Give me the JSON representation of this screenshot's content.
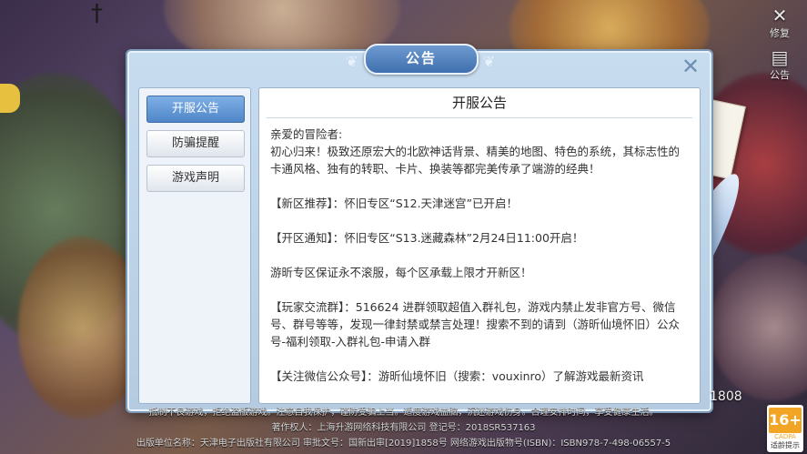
{
  "corner": {
    "repair_label": "修复",
    "notice_label": "公告"
  },
  "dialog": {
    "title": "公告",
    "tabs": [
      {
        "label": "开服公告"
      },
      {
        "label": "防骗提醒"
      },
      {
        "label": "游戏声明"
      }
    ],
    "content_title": "开服公告",
    "paragraphs": [
      "亲爱的冒险者:",
      "初心归来！极致还原宏大的北欧神话背景、精美的地图、特色的系统，其标志性的卡通风格、独有的转职、卡片、换装等都完美传承了端游的经典！",
      "【新区推荐】：怀旧专区“S12.天津迷宫”已开启！",
      "【开区通知】：怀旧专区“S13.迷藏森林”2月24日11:00开启！",
      "游昕专区保证永不滚服，每个区承载上限才开新区！",
      "【玩家交流群】：516624 进群领取超值入群礼包，游戏内禁止发非官方号、微信号、群号等等，发现一律封禁或禁言处理！搜索不到的请到（游昕仙境怀旧）公众号-福利领取-入群礼包-申请入群",
      "【关注微信公众号】：游昕仙境怀旧（搜索：vouxinro）了解游戏最新资讯"
    ]
  },
  "footer": {
    "line1": "抵制不良游戏，拒绝盗版游戏。注意自我保护，谨防受骗上当。适度游戏益脑，沉迷游戏伤身。合理安排时间，享受健康生活。",
    "line2": "著作权人：上海升游网络科技有限公司 登记号：2018SR537163",
    "line3": "出版单位名称：天津电子出版社有限公司 审批文号：国新出审[2019]1858号 网络游戏出版物号(ISBN)：ISBN978-7-498-06557-5",
    "side_number": "1808"
  },
  "age_rating": {
    "age": "16+",
    "org": "CADPA",
    "tip": "适龄提示"
  }
}
